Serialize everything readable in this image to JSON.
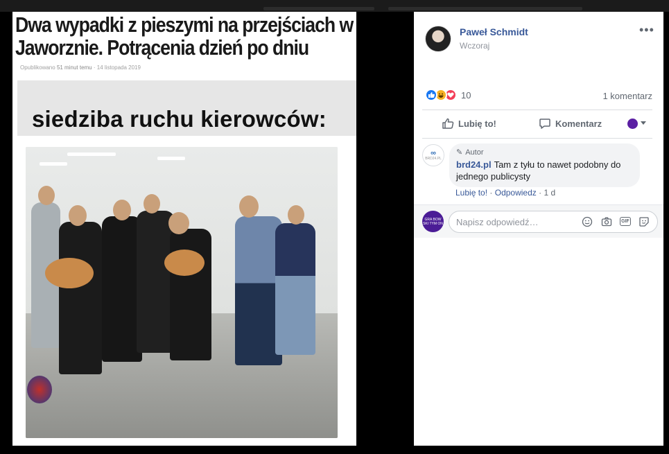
{
  "article": {
    "headline": "Dwa wypadki z pieszymi na przejściach w Jaworznie. Potrącenia dzień po dniu",
    "meta_prefix": "Opublikowano",
    "meta_time": "51 minut temu",
    "meta_sep": "·",
    "meta_date": "14 listopada 2019",
    "caption": "siedziba ruchu kierowców:"
  },
  "post": {
    "author": "Paweł Schmidt",
    "time": "Wczoraj",
    "more": "•••",
    "reaction_count": "10",
    "comment_count": "1 komentarz",
    "like_label": "Lubię to!",
    "comment_label": "Komentarz"
  },
  "comment": {
    "badge": "Autor",
    "avatar_text": "∞",
    "avatar_sub": "BRD24.PL",
    "author": "brd24.pl",
    "text": "Tam z tyłu to nawet podobny do jednego publicysty",
    "like": "Lubię to!",
    "reply": "Odpowiedz",
    "age": "1 d"
  },
  "reply": {
    "avatar_text": "GRA BOW SKI TYM ON",
    "placeholder": "Napisz odpowiedź…",
    "icons": [
      "emoji-icon",
      "camera-icon",
      "gif-icon",
      "sticker-icon"
    ]
  },
  "colors": {
    "link": "#385898",
    "like": "#1877f2",
    "haha": "#f7b125",
    "love": "#f33e58"
  }
}
